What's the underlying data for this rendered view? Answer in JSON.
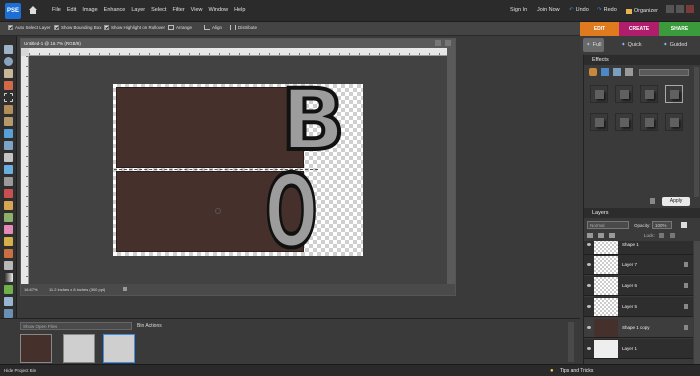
{
  "app": {
    "logo": "PSE"
  },
  "menu": {
    "items": [
      "File",
      "Edit",
      "Image",
      "Enhance",
      "Layer",
      "Select",
      "Filter",
      "View",
      "Window",
      "Help"
    ],
    "sign_in": "Sign In",
    "join_now": "Join Now",
    "undo": "Undo",
    "redo": "Redo",
    "organizer": "Organizer"
  },
  "options": {
    "auto_select_layer": "Auto Select Layer",
    "show_bounding_box": "Show Bounding Box",
    "show_highlight": "Show Highlight on Rollover",
    "arrange": "Arrange",
    "align": "Align",
    "distribute": "Distribute"
  },
  "modes": {
    "edit": "EDIT",
    "create": "CREATE",
    "share": "SHARE"
  },
  "submodes": {
    "full": "Full",
    "quick": "Quick",
    "guided": "Guided"
  },
  "document": {
    "title": "Untitled-1 @ 16.7% (RGB/8)",
    "zoom": "16.67%",
    "info": "11.2 inches x 8 inches (300 ppi)",
    "letters": [
      "B",
      "O"
    ]
  },
  "effects": {
    "header": "Effects",
    "apply": "Apply"
  },
  "layers": {
    "header": "Layers",
    "blend_mode": "Normal",
    "opacity_label": "Opacity:",
    "opacity_value": "100%",
    "lock_label": "Lock:",
    "rows": [
      {
        "name": "Shape 1"
      },
      {
        "name": "Layer 7"
      },
      {
        "name": "Layer 6"
      },
      {
        "name": "Layer 5"
      },
      {
        "name": "Shape 1 copy"
      },
      {
        "name": "Layer 1"
      }
    ]
  },
  "bin": {
    "select_placeholder": "Show Open Files",
    "actions": "Bin Actions",
    "hide": "Hide Project Bin"
  },
  "footer": {
    "tips": "Tips and Tricks"
  },
  "colors": {
    "edit_tab": "#e07a1f",
    "create_tab": "#b01d6c",
    "share_tab": "#3b9a3c",
    "shape_fill": "#46302b",
    "app_bg": "#3a3a3a"
  }
}
